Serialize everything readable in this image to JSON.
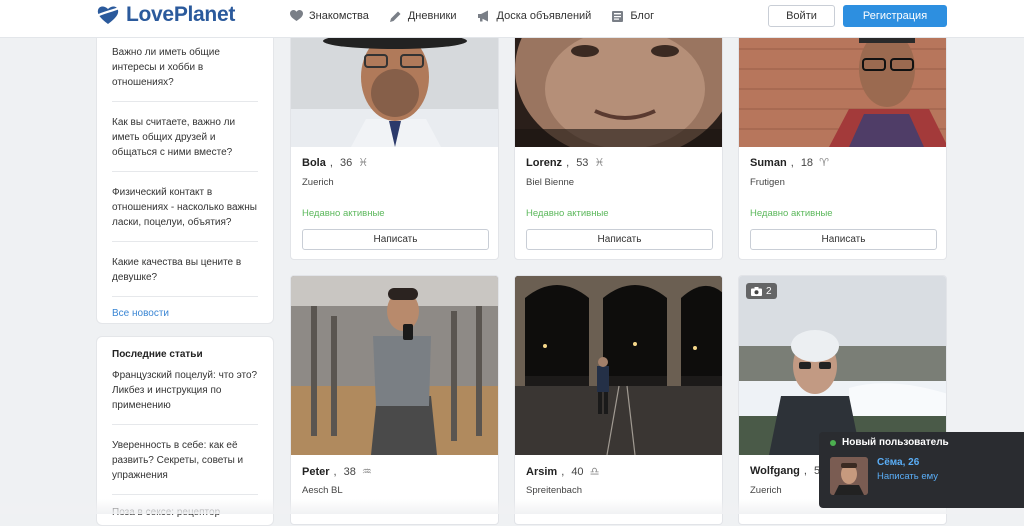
{
  "header": {
    "logo_text": "LovePlanet",
    "nav": [
      {
        "label": "Знакомства",
        "icon": "heart-icon"
      },
      {
        "label": "Дневники",
        "icon": "pencil-icon"
      },
      {
        "label": "Доска объявлений",
        "icon": "megaphone-icon"
      },
      {
        "label": "Блог",
        "icon": "newspaper-icon"
      }
    ],
    "login_label": "Войти",
    "register_label": "Регистрация"
  },
  "sidebar": {
    "questions": [
      "Важно ли иметь общие интересы и хобби в отношениях?",
      "Как вы считаете, важно ли иметь общих друзей и общаться с ними вместе?",
      "Физический контакт в отношениях - насколько важны ласки, поцелуи, объятия?",
      "Какие качества вы цените в девушке?"
    ],
    "all_news": "Все новости",
    "articles_title": "Последние статьи",
    "articles": [
      "Французский поцелуй: что это? Ликбез и инструкция по применению",
      "Уверенность в себе: как её развить? Секреты, советы и упражнения",
      "Поза в сексе: рецептор"
    ]
  },
  "cards": [
    {
      "name": "Bola",
      "age": "36",
      "zodiac": "♓",
      "city": "Zuerich",
      "status": "Недавно активные",
      "button": "Написать"
    },
    {
      "name": "Lorenz",
      "age": "53",
      "zodiac": "♓",
      "city": "Biel Bienne",
      "status": "Недавно активные",
      "button": "Написать"
    },
    {
      "name": "Suman",
      "age": "18",
      "zodiac": "♈",
      "city": "Frutigen",
      "status": "Недавно активные",
      "button": "Написать"
    },
    {
      "name": "Peter",
      "age": "38",
      "zodiac": "♒",
      "city": "Aesch BL"
    },
    {
      "name": "Arsim",
      "age": "40",
      "zodiac": "♎",
      "city": "Spreitenbach"
    },
    {
      "name": "Wolfgang",
      "age": "57",
      "city": "Zuerich",
      "photo_count": "2"
    }
  ],
  "notification": {
    "title": "Новый пользователь",
    "name": "Сёма, 26",
    "link": "Написать ему"
  }
}
